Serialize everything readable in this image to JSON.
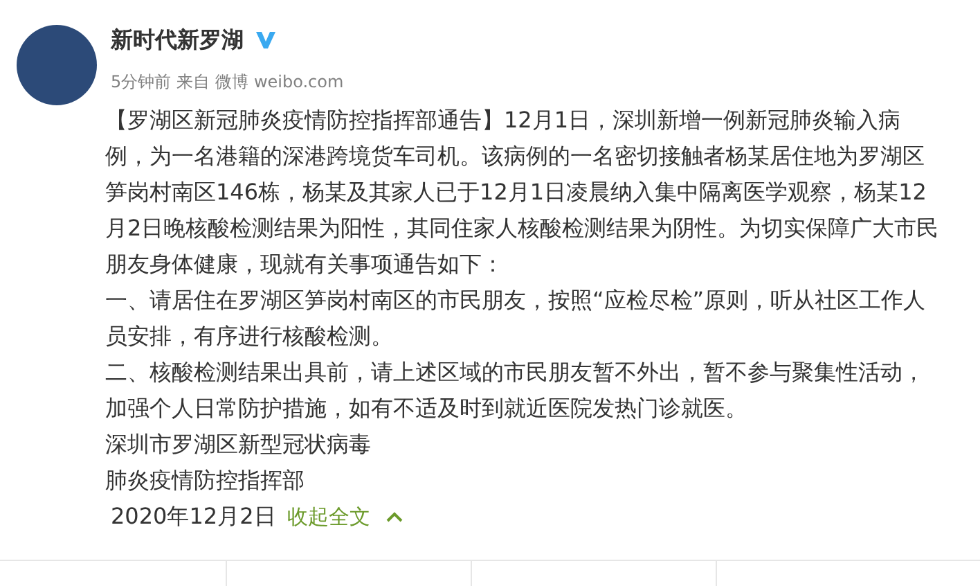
{
  "post": {
    "author": "新时代新罗湖",
    "verified": true,
    "time": "5分钟前",
    "source_prefix": "来自",
    "source": "微博 weibo.com",
    "paragraphs": [
      "【罗湖区新冠肺炎疫情防控指挥部通告】12月1日，深圳新增一例新冠肺炎输入病例，为一名港籍的深港跨境货车司机。该病例的一名密切接触者杨某居住地为罗湖区笋岗村南区146栋，杨某及其家人已于12月1日凌晨纳入集中隔离医学观察，杨某12月2日晚核酸检测结果为阳性，其同住家人核酸检测结果为阴性。为切实保障广大市民朋友身体健康，现就有关事项通告如下：",
      "一、请居住在罗湖区笋岗村南区的市民朋友，按照“应检尽检”原则，听从社区工作人员安排，有序进行核酸检测。",
      "二、核酸检测结果出具前，请上述区域的市民朋友暂不外出，暂不参与聚集性活动，加强个人日常防护措施，如有不适及时到就近医院发热门诊就医。",
      "深圳市罗湖区新型冠状病毒",
      "肺炎疫情防控指挥部"
    ],
    "date": "2020年12月2日",
    "collapse_link": "收起全文"
  }
}
